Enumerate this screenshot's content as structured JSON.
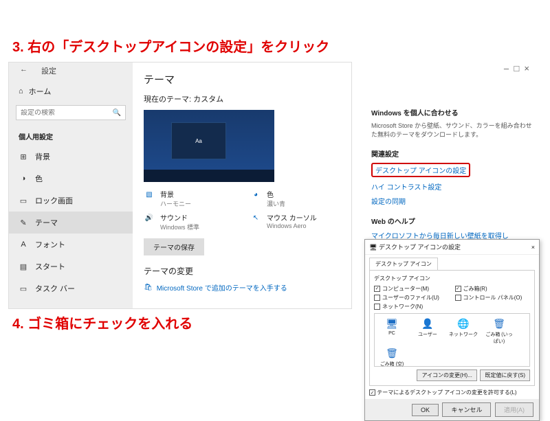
{
  "instructions": {
    "step3": "3. 右の「デスクトップアイコンの設定」をクリック",
    "step4": "4. ゴミ箱にチェックを入れる"
  },
  "settings": {
    "back": "←",
    "title": "設定",
    "home": "ホーム",
    "search_placeholder": "設定の検索",
    "section": "個人用設定",
    "nav": [
      {
        "icon": "⊞",
        "label": "背景"
      },
      {
        "icon": "◑",
        "label": "色"
      },
      {
        "icon": "▭",
        "label": "ロック画面"
      },
      {
        "icon": "✎",
        "label": "テーマ"
      },
      {
        "icon": "A",
        "label": "フォント"
      },
      {
        "icon": "▤",
        "label": "スタート"
      },
      {
        "icon": "▭",
        "label": "タスク バー"
      }
    ],
    "main": {
      "h1": "テーマ",
      "current": "現在のテーマ: カスタム",
      "preview_sample": "Aa",
      "opts": [
        {
          "icon": "▧",
          "t": "背景",
          "s": "ハーモニー"
        },
        {
          "icon": "◕",
          "t": "色",
          "s": "濃い青"
        },
        {
          "icon": "🔊",
          "t": "サウンド",
          "s": "Windows 標準"
        },
        {
          "icon": "↖",
          "t": "マウス カーソル",
          "s": "Windows Aero"
        }
      ],
      "save": "テーマの保存",
      "h2": "テーマの変更",
      "store": "Microsoft Store で追加のテーマを入手する"
    }
  },
  "right": {
    "personalize_h": "Windows を個人に合わせる",
    "personalize_p": "Microsoft Store から壁紙、サウンド、カラーを組み合わせた無料のテーマをダウンロードします。",
    "related_h": "関連設定",
    "link_desktop_icons": "デスクトップ アイコンの設定",
    "link_contrast": "ハイ コントラスト設定",
    "link_sync": "設定の同期",
    "help_h": "Web のヘルプ",
    "help_link": "マイクロソフトから毎日新しい壁紙を取得し"
  },
  "dialog": {
    "title": "デスクトップ アイコンの設定",
    "close": "×",
    "tab": "デスクトップ アイコン",
    "group": "デスクトップ アイコン",
    "checks": [
      {
        "label": "コンピューター(M)",
        "checked": true
      },
      {
        "label": "ごみ箱(R)",
        "checked": true
      },
      {
        "label": "ユーザーのファイル(U)",
        "checked": false
      },
      {
        "label": "コントロール パネル(O)",
        "checked": false
      },
      {
        "label": "ネットワーク(N)",
        "checked": false
      }
    ],
    "icons": [
      {
        "glyph": "🖥",
        "label": "PC"
      },
      {
        "glyph": "👤",
        "label": "ユーザー"
      },
      {
        "glyph": "🌐",
        "label": "ネットワーク"
      },
      {
        "glyph": "🗑",
        "label": "ごみ箱 (いっぱい)"
      },
      {
        "glyph": "🗑",
        "label": "ごみ箱 (空)"
      }
    ],
    "btn_change": "アイコンの変更(H)...",
    "btn_default": "既定値に戻す(S)",
    "theme_chk": "テーマによるデスクトップ アイコンの変更を許可する(L)",
    "ok": "OK",
    "cancel": "キャンセル",
    "apply": "適用(A)"
  }
}
